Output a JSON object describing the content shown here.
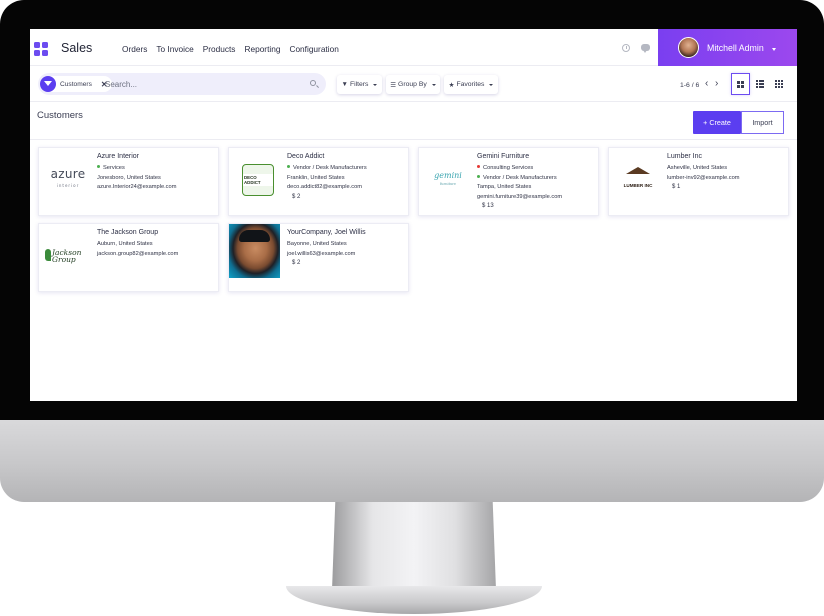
{
  "app": {
    "name": "Sales"
  },
  "menu": [
    "Orders",
    "To Invoice",
    "Products",
    "Reporting",
    "Configuration"
  ],
  "user": {
    "name": "Mitchell Admin"
  },
  "search": {
    "facet": "Customers",
    "placeholder": "Search..."
  },
  "buttons": {
    "filters": "Filters",
    "group_by": "Group By",
    "favorites": "Favorites",
    "create": "Create",
    "import": "Import"
  },
  "pager": {
    "value": "1-6 / 6"
  },
  "page_title": "Customers",
  "colors": {
    "brand": "#5b3ef0",
    "user_bar": "#8a44ef",
    "tag_green": "#4caf50",
    "tag_red": "#e53935"
  },
  "customers": [
    {
      "name": "Azure Interior",
      "tags": [
        {
          "label": "Services",
          "color": "#4caf50"
        }
      ],
      "location": "Jonesboro, United States",
      "email": "azure.Interior24@example.com",
      "logo": "azure",
      "logo_text": "azure",
      "logo_sub": "interior"
    },
    {
      "name": "Deco Addict",
      "tags": [
        {
          "label": "Vendor / Desk Manufacturers",
          "color": "#4caf50"
        }
      ],
      "location": "Franklin, United States",
      "email": "deco.addict82@example.com",
      "stat": "$ 2",
      "logo": "deco",
      "logo_text": "DECO ADDICT"
    },
    {
      "name": "Gemini Furniture",
      "tags": [
        {
          "label": "Consulting Services",
          "color": "#e53935"
        },
        {
          "label": "Vendor / Desk Manufacturers",
          "color": "#4caf50"
        }
      ],
      "location": "Tampa, United States",
      "email": "gemini.furniture39@example.com",
      "stat": "$ 13",
      "logo": "gemini",
      "logo_text": "gemini",
      "logo_sub": "furniture"
    },
    {
      "name": "Lumber Inc",
      "tags": [],
      "location": "Asheville, United States",
      "email": "lumber-inv92@example.com",
      "stat": "$ 1",
      "logo": "lumber",
      "logo_text": "LUMBER INC"
    },
    {
      "name": "The Jackson Group",
      "tags": [],
      "location": "Auburn, United States",
      "email": "jackson.group82@example.com",
      "logo": "jackson",
      "logo_text": "Jackson Group"
    },
    {
      "name": "YourCompany, Joel Willis",
      "tags": [],
      "location": "Bayonne, United States",
      "email": "joel.willis63@example.com",
      "stat": "$ 2",
      "logo": "photo"
    }
  ]
}
